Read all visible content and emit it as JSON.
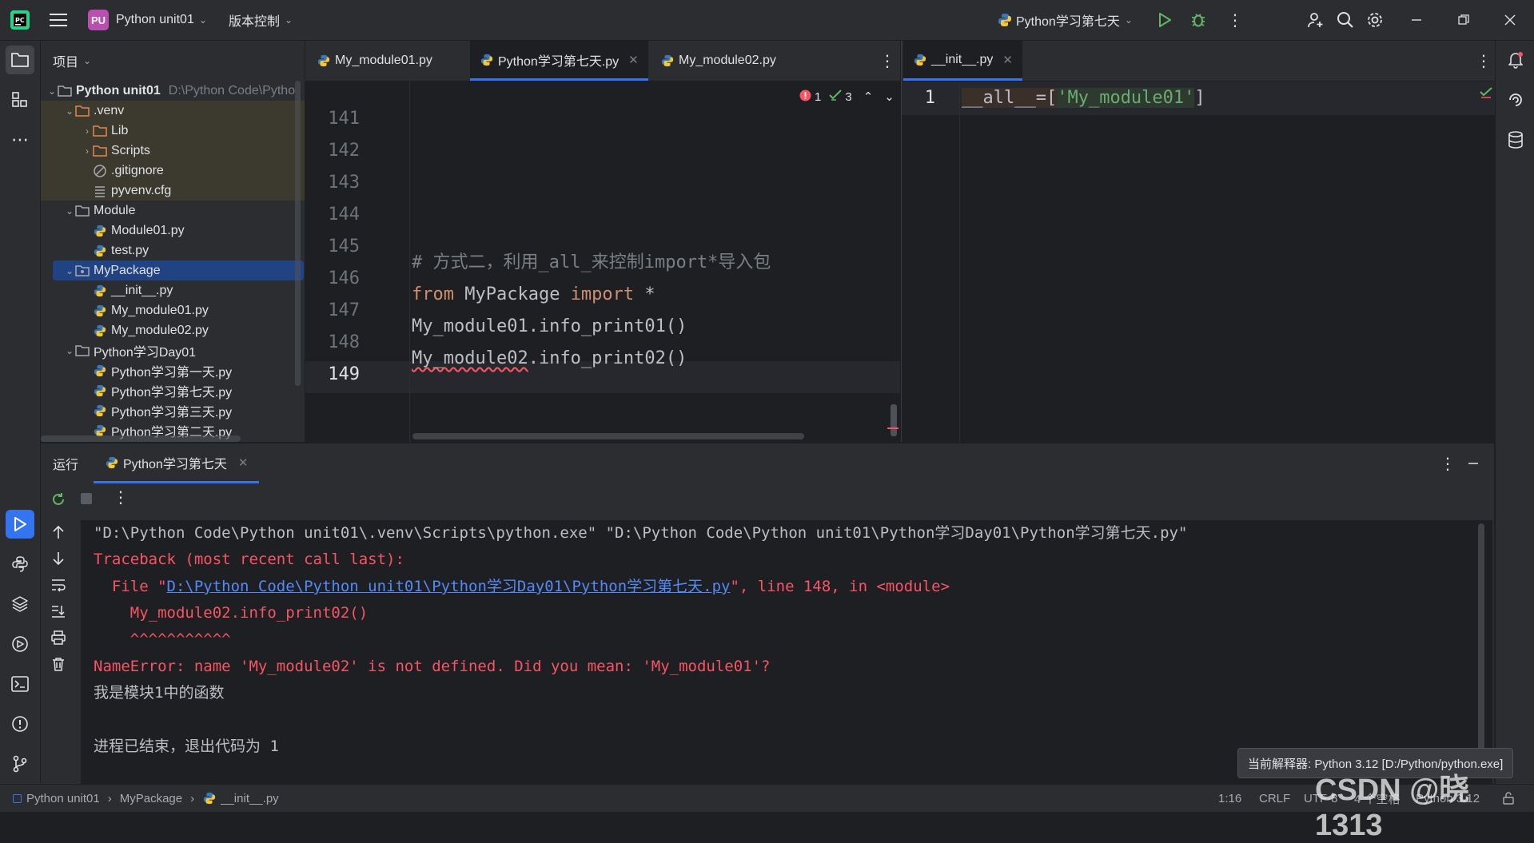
{
  "titlebar": {
    "project_badge": "PU",
    "project_name": "Python unit01",
    "vcs_label": "版本控制",
    "run_config": "Python学习第七天"
  },
  "project_panel": {
    "header": "项目",
    "root_name": "Python unit01",
    "root_path": "D:\\Python Code\\Pytho",
    "items": [
      {
        "label": ".venv"
      },
      {
        "label": "Lib"
      },
      {
        "label": "Scripts"
      },
      {
        "label": ".gitignore"
      },
      {
        "label": "pyvenv.cfg"
      },
      {
        "label": "Module"
      },
      {
        "label": "Module01.py"
      },
      {
        "label": "test.py"
      },
      {
        "label": "MyPackage"
      },
      {
        "label": "__init__.py"
      },
      {
        "label": "My_module01.py"
      },
      {
        "label": "My_module02.py"
      },
      {
        "label": "Python学习Day01"
      },
      {
        "label": "Python学习第一天.py"
      },
      {
        "label": "Python学习第七天.py"
      },
      {
        "label": "Python学习第三天.py"
      },
      {
        "label": "Python学习第二天.py"
      }
    ]
  },
  "editor_left": {
    "tabs": [
      {
        "label": "My_module01.py"
      },
      {
        "label": "Python学习第七天.py"
      },
      {
        "label": "My_module02.py"
      }
    ],
    "inspections": {
      "errors": "1",
      "warnings": "3"
    },
    "line_numbers": [
      "141",
      "142",
      "143",
      "144",
      "145",
      "146",
      "147",
      "148",
      "149"
    ],
    "comment": "# 方式二，利用_all_来控制import*导入包",
    "kw_from": "from",
    "pkg": " MyPackage ",
    "kw_import": "import",
    "star": " *",
    "call1": "My_module01.info_print01()",
    "call2_name": "My_module02",
    "call2_rest": ".info_print02()"
  },
  "editor_right": {
    "tab": "__init__.py",
    "line_number": "1",
    "code_prefix": "__all__=[",
    "code_str": "'My_module01'",
    "code_suffix": "]"
  },
  "run_panel": {
    "title": "运行",
    "tab": "Python学习第七天",
    "lines": {
      "cmd": "\"D:\\Python Code\\Python unit01\\.venv\\Scripts\\python.exe\" \"D:\\Python Code\\Python unit01\\Python学习Day01\\Python学习第七天.py\"",
      "tb": "Traceback (most recent call last):",
      "file_pre": "  File \"",
      "file_link": "D:\\Python Code\\Python unit01\\Python学习Day01\\Python学习第七天.py",
      "file_post": "\", line 148, in <module>",
      "src": "    My_module02.info_print02()",
      "caret": "    ^^^^^^^^^^^",
      "nameerror": "NameError: name 'My_module02' is not defined. Did you mean: 'My_module01'?",
      "output": "我是模块1中的函数",
      "exit": "进程已结束，退出代码为 1"
    }
  },
  "statusbar": {
    "crumb1": "Python unit01",
    "crumb2": "MyPackage",
    "crumb3": "__init__.py",
    "position": "1:16",
    "line_sep": "CRLF",
    "encoding": "UTF-8",
    "indent": "4 个空格",
    "interpreter": "Python 3.12"
  },
  "tooltip": "当前解释器: Python 3.12 [D:/Python/python.exe]",
  "watermark": "CSDN @晓1313",
  "colors": {
    "accent": "#3574f0",
    "error": "#f75464",
    "keyword": "#cf8e6d",
    "string": "#6aab73",
    "link": "#548af7"
  }
}
